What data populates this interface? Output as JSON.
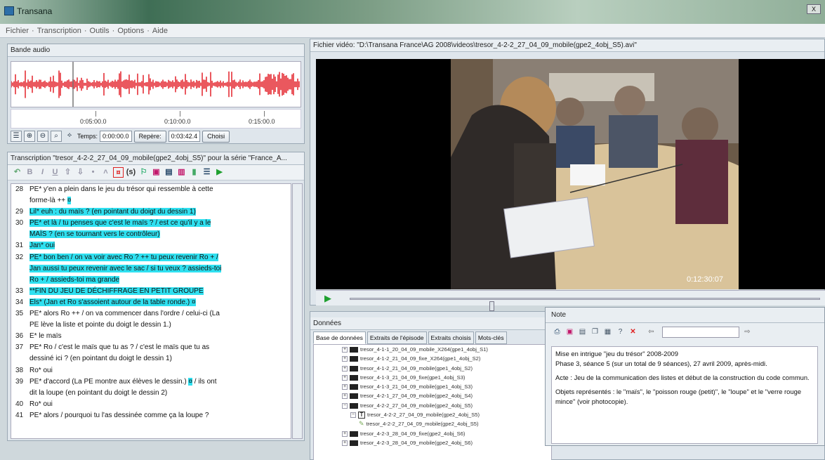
{
  "window": {
    "title": "Transana",
    "close_label": "X"
  },
  "menu": {
    "items": [
      "Fichier",
      "Transcription",
      "Outils",
      "Options",
      "Aide"
    ]
  },
  "audio": {
    "title": "Bande audio",
    "ticks": [
      "0:05:00.0",
      "0:10:00.0",
      "0:15:00.0"
    ],
    "tools": [
      "list-icon",
      "zoom-in-icon",
      "zoom-out-icon",
      "zoom-icon",
      "search-icon"
    ],
    "time_label": "Temps:",
    "time_value": "0:00:00.0",
    "repere_label": "Repère:",
    "repere_value": "0:03:42.4",
    "choose_label": "Choisi"
  },
  "transcription": {
    "title": "Transcription \"tresor_4-2-2_27_04_09_mobile(gpe2_4obj_S5)\" pour la série \"France_A...",
    "lines": [
      {
        "num": "28",
        "segs": [
          {
            "t": "PE* y'en a plein dans le jeu du trésor qui ressemble à cette",
            "hl": false
          }
        ]
      },
      {
        "num": "",
        "segs": [
          {
            "t": "forme-là ++ ",
            "hl": false
          },
          {
            "t": "¤",
            "hl": true
          }
        ]
      },
      {
        "num": "29",
        "segs": [
          {
            "t": "Lil* euh : du maïs ? (en pointant du doigt du dessin 1)",
            "hl": true
          }
        ]
      },
      {
        "num": "30",
        "segs": [
          {
            "t": "PE* et là / tu penses que c'est le maïs ? / est ce qu'il y a le",
            "hl": true
          }
        ]
      },
      {
        "num": "",
        "segs": [
          {
            "t": "MAÏS ? (en se tournant vers le contrôleur)",
            "hl": true
          }
        ]
      },
      {
        "num": "31",
        "segs": [
          {
            "t": "Jan* oui",
            "hl": true
          }
        ]
      },
      {
        "num": "32",
        "segs": [
          {
            "t": "PE* bon ben / on va voir avec Ro ? ++ tu peux revenir Ro + /",
            "hl": true
          }
        ]
      },
      {
        "num": "",
        "segs": [
          {
            "t": "Jan aussi tu peux revenir avec le sac / si tu veux ? assieds-toi",
            "hl": true
          }
        ]
      },
      {
        "num": "",
        "segs": [
          {
            "t": "Ro + / assieds-toi ma grande",
            "hl": true
          }
        ]
      },
      {
        "num": "33",
        "segs": [
          {
            "t": "**FIN DU JEU DE DÉCHIFFRAGE EN PETIT GROUPE",
            "hl": true
          }
        ]
      },
      {
        "num": "34",
        "segs": [
          {
            "t": "Els* (Jan et Ro s'assoient autour de la table ronde.) ",
            "hl": true
          },
          {
            "t": "¤",
            "hl": true
          }
        ]
      },
      {
        "num": "35",
        "segs": [
          {
            "t": "PE* alors Ro ++ / on va commencer dans l'ordre / celui-ci (La",
            "hl": false
          }
        ]
      },
      {
        "num": "",
        "segs": [
          {
            "t": "PE lève la liste et pointe du doigt le dessin 1.)",
            "hl": false
          }
        ]
      },
      {
        "num": "36",
        "segs": [
          {
            "t": "E* le maïs",
            "hl": false
          }
        ]
      },
      {
        "num": "37",
        "segs": [
          {
            "t": "PE* Ro / c'est le maïs que tu as ? / c'est le maïs que tu as",
            "hl": false
          }
        ]
      },
      {
        "num": "",
        "segs": [
          {
            "t": "dessiné ici ? (en pointant du doigt le dessin 1)",
            "hl": false
          }
        ]
      },
      {
        "num": "38",
        "segs": [
          {
            "t": "Ro* oui",
            "hl": false
          }
        ]
      },
      {
        "num": "39",
        "segs": [
          {
            "t": "PE* d'accord (La PE montre aux élèves le dessin.) ",
            "hl": false
          },
          {
            "t": "¤",
            "hl": true
          },
          {
            "t": " / ils ont",
            "hl": false
          }
        ]
      },
      {
        "num": "",
        "segs": [
          {
            "t": "dit la loupe (en pointant du doigt le dessin 2)",
            "hl": false
          }
        ]
      },
      {
        "num": "40",
        "segs": [
          {
            "t": "Ro* oui",
            "hl": false
          }
        ]
      },
      {
        "num": "41",
        "segs": [
          {
            "t": "PE* alors / pourquoi tu l'as dessinée comme ça la loupe ?",
            "hl": false
          }
        ]
      }
    ]
  },
  "video": {
    "title": "Fichier vidéo: \"D:\\Transana France\\AG 2008\\videos\\tresor_4-2-2_27_04_09_mobile(gpe2_4obj_S5).avi\"",
    "timecode": "0:12:30:07",
    "progress": 0.3
  },
  "donnees": {
    "title": "Données",
    "tabs": [
      "Base de données",
      "Extraits de l'épisode",
      "Extraits choisis",
      "Mots-clés"
    ],
    "tree": [
      {
        "label": "tresor_4-1-1_20_04_09_mobile_X264(gpe1_4obj_S1)",
        "indent": 0,
        "kind": "video"
      },
      {
        "label": "tresor_4-1-2_21_04_09_fixe_X264(gpe1_4obj_S2)",
        "indent": 0,
        "kind": "video"
      },
      {
        "label": "tresor_4-1-2_21_04_09_mobile(gpe1_4obj_S2)",
        "indent": 0,
        "kind": "video"
      },
      {
        "label": "tresor_4-1-3_21_04_09_fixe(gpe1_4obj_S3)",
        "indent": 0,
        "kind": "video"
      },
      {
        "label": "tresor_4-1-3_21_04_09_mobile(gpe1_4obj_S3)",
        "indent": 0,
        "kind": "video"
      },
      {
        "label": "tresor_4-2-1_27_04_09_mobile(gpe2_4obj_S4)",
        "indent": 0,
        "kind": "video"
      },
      {
        "label": "tresor_4-2-2_27_04_09_mobile(gpe2_4obj_S5)",
        "indent": 0,
        "kind": "video",
        "open": true
      },
      {
        "label": "tresor_4-2-2_27_04_09_mobile(gpe2_4obj_S5)",
        "indent": 1,
        "kind": "transcript"
      },
      {
        "label": "tresor_4-2-2_27_04_09_mobile(gpe2_4obj_S5)",
        "indent": 2,
        "kind": "note"
      },
      {
        "label": "tresor_4-2-3_28_04_09_fixe(gpe2_4obj_S6)",
        "indent": 0,
        "kind": "video"
      },
      {
        "label": "tresor_4-2-3_28_04_09_mobile(gpe2_4obj_S6)",
        "indent": 0,
        "kind": "video"
      }
    ]
  },
  "note": {
    "title": "Note",
    "paragraphs": [
      "Mise en intrigue  \"jeu du trésor\" 2008-2009\nPhase 3, séance 5 (sur un total de 9 séances), 27 avril 2009, après-midi.",
      "Acte : Jeu de la communication des listes et début de la construction du code commun.",
      "Objets représentés : le \"maïs\", le \"poisson rouge (petit)\", le \"loupe\" et le \"verre rouge mince\" (voir photocopie)."
    ]
  },
  "colors": {
    "highlight": "#2fe0f0",
    "waveform": "#e0101a",
    "play": "#1fa02f",
    "stop": "#e02020"
  }
}
